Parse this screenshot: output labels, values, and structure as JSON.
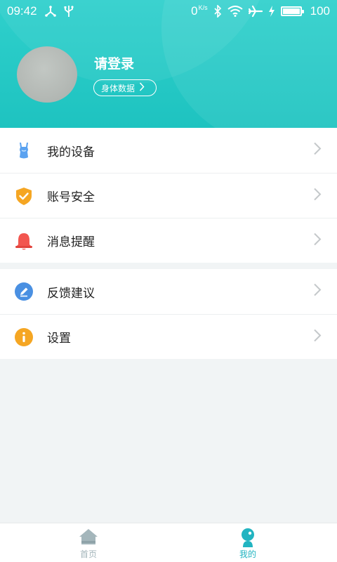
{
  "status_bar": {
    "time": "09:42",
    "net_speed": "0",
    "net_speed_unit": "K/s",
    "battery": "100"
  },
  "profile": {
    "login_prompt": "请登录",
    "body_data_label": "身体数据"
  },
  "menu_section_1": [
    {
      "label": "我的设备",
      "icon": "device-icon"
    },
    {
      "label": "账号安全",
      "icon": "shield-check-icon"
    },
    {
      "label": "消息提醒",
      "icon": "bell-icon"
    }
  ],
  "menu_section_2": [
    {
      "label": "反馈建议",
      "icon": "pencil-icon"
    },
    {
      "label": "设置",
      "icon": "info-icon"
    }
  ],
  "tab_bar": {
    "home_label": "首页",
    "mine_label": "我的",
    "active": "我的"
  },
  "colors": {
    "header": "#22c6c2",
    "active_tab": "#22b4c1",
    "inactive_tab": "#a4b6bb",
    "background": "#f1f4f5"
  }
}
